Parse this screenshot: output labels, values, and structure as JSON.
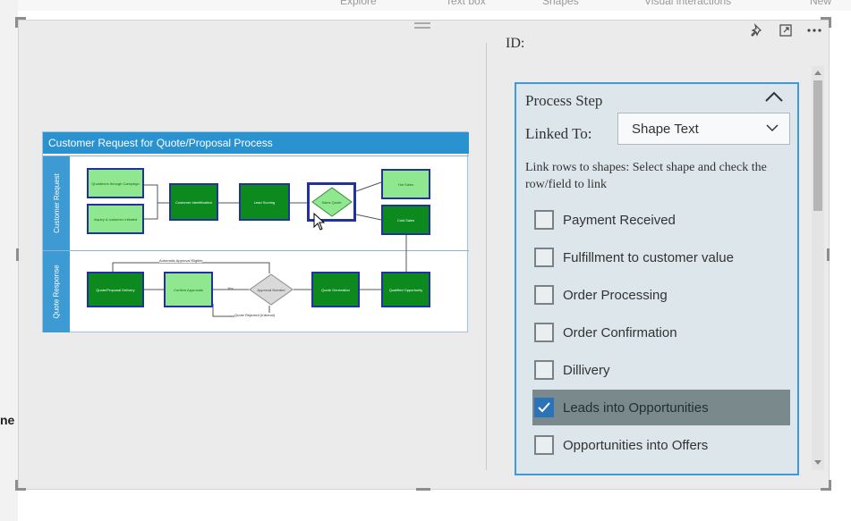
{
  "toolbar": {
    "items": [
      "Explore",
      "Text box",
      "Shapes",
      "Visual interactions",
      "New"
    ]
  },
  "left_fragment": "ne",
  "diagram": {
    "title": "Customer Request for Quote/Proposal Process",
    "lanes": [
      "Customer Request",
      "Quote Response"
    ],
    "nodes": [
      "Quotations through Campaign",
      "Inquiry & customer Initiated",
      "Customer Identification",
      "Lead Scoring",
      "Sales Quote",
      "Hot Sales",
      "Cold Sales",
      "Qualified Opportunity",
      "Quote Generation",
      "Approval Needed",
      "Confirm Approvals",
      "Quote/Proposal Delivery"
    ],
    "edge_labels": [
      "Automatic Approval Eligible",
      "Quote Rejected (Internal)",
      "Yes"
    ]
  },
  "pane": {
    "heading": "ID:",
    "card_title": "Process Step",
    "linked_to_label": "Linked To:",
    "linked_to_value": "Shape Text",
    "hint": "Link rows to shapes: Select shape and check the row/field to link",
    "rows": [
      {
        "label": "Payment Received",
        "checked": false
      },
      {
        "label": "Fulfillment to customer value",
        "checked": false
      },
      {
        "label": "Order Processing",
        "checked": false
      },
      {
        "label": "Order Confirmation",
        "checked": false
      },
      {
        "label": "Dillivery",
        "checked": false
      },
      {
        "label": "Leads into Opportunities",
        "checked": true
      },
      {
        "label": "Opportunities into Offers",
        "checked": false
      }
    ]
  },
  "icons": [
    "pin-icon",
    "focus-mode-icon",
    "more-options-icon",
    "chevron-up-icon",
    "chevron-down-icon",
    "checkmark-icon"
  ],
  "colors": {
    "accent": "#3e9ad6",
    "diagram_header": "#2a92cf",
    "node_dark": "#0c8a1e",
    "node_light": "#8fe88f",
    "selected_row": "#7a8a8c",
    "checkbox_checked": "#2b73b9"
  }
}
